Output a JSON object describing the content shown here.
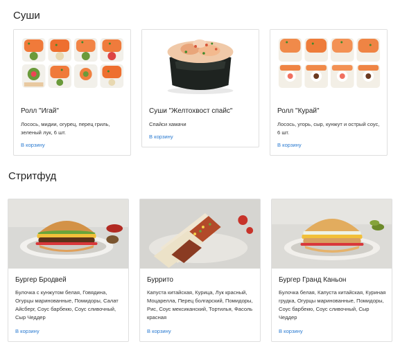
{
  "sections": [
    {
      "title": "Суши",
      "products": [
        {
          "name": "Ролл \"Игай\"",
          "description": "Лосось, мидии, огурец, перец гриль, зеленый лук, 6 шт.",
          "cart_label": "В корзину",
          "image": "roll-igai-image"
        },
        {
          "name": "Суши \"Желтохвост спайс\"",
          "description": "Спайси хамачи",
          "cart_label": "В корзину",
          "image": "sushi-yellowtail-image"
        },
        {
          "name": "Ролл \"Курай\"",
          "description": "Лосось, угорь, сыр, кунжут и острый соус, 6 шт.",
          "cart_label": "В корзину",
          "image": "roll-kurai-image"
        }
      ]
    },
    {
      "title": "Стритфуд",
      "products": [
        {
          "name": "Бургер Бродвей",
          "description": "Булочка с кунжутом белая, Говядина, Огурцы маринованные, Помидоры, Салат Айсберг, Соус барбекю, Соус сливочный, Сыр Чеддер",
          "cart_label": "В корзину",
          "image": "burger-broadway-image"
        },
        {
          "name": "Буррито",
          "description": "Капуста китайская, Курица, Лук красный, Моцарелла, Перец болгарский, Помидоры, Рис, Соус мексиканский, Тортилья, Фасоль красная",
          "cart_label": "В корзину",
          "image": "burrito-image"
        },
        {
          "name": "Бургер Гранд Каньон",
          "description": "Булочка белая, Капуста китайская, Куриная грудка, Огурцы маринованные, Помидоры, Соус барбекю, Соус сливочный, Сыр Чеддер",
          "cart_label": "В корзину",
          "image": "burger-grand-canyon-image"
        }
      ]
    }
  ]
}
